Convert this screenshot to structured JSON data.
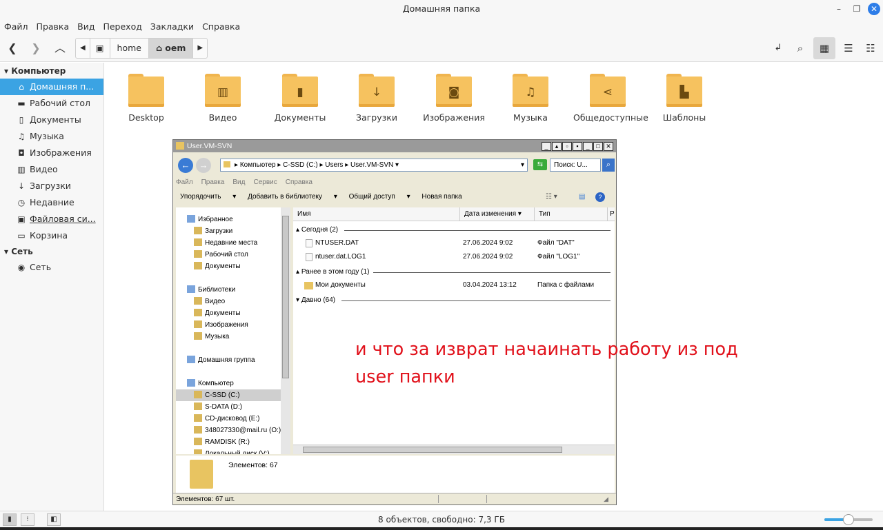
{
  "window": {
    "title": "Домашняя папка"
  },
  "menubar": [
    "Файл",
    "Правка",
    "Вид",
    "Переход",
    "Закладки",
    "Справка"
  ],
  "breadcrumb": [
    "home",
    "oem"
  ],
  "sidebar": {
    "sections": [
      {
        "title": "Компьютер",
        "items": [
          {
            "label": "Домашняя п...",
            "icon": "home-icon",
            "selected": true
          },
          {
            "label": "Рабочий стол",
            "icon": "desktop-icon"
          },
          {
            "label": "Документы",
            "icon": "document-icon"
          },
          {
            "label": "Музыка",
            "icon": "music-icon"
          },
          {
            "label": "Изображения",
            "icon": "camera-icon"
          },
          {
            "label": "Видео",
            "icon": "film-icon"
          },
          {
            "label": "Загрузки",
            "icon": "download-icon"
          },
          {
            "label": "Недавние",
            "icon": "clock-icon"
          },
          {
            "label": "Файловая си...",
            "icon": "drive-icon"
          },
          {
            "label": "Корзина",
            "icon": "trash-icon"
          }
        ]
      },
      {
        "title": "Сеть",
        "items": [
          {
            "label": "Сеть",
            "icon": "network-icon"
          }
        ]
      }
    ]
  },
  "folders": [
    {
      "label": "Desktop",
      "icon": "folder-icon"
    },
    {
      "label": "Видео",
      "icon": "film-icon"
    },
    {
      "label": "Документы",
      "icon": "document-icon"
    },
    {
      "label": "Загрузки",
      "icon": "download-icon"
    },
    {
      "label": "Изображения",
      "icon": "camera-icon"
    },
    {
      "label": "Музыка",
      "icon": "music-icon"
    },
    {
      "label": "Общедоступные",
      "icon": "share-icon"
    },
    {
      "label": "Шаблоны",
      "icon": "template-icon"
    }
  ],
  "status": {
    "text": "8 объектов, свободно: 7,3 ГБ",
    "zoom_level": 0.5
  },
  "screenshot": {
    "title": "User.VM-SVN",
    "address": [
      "Компьютер",
      "C-SSD (C:)",
      "Users",
      "User.VM-SVN"
    ],
    "search_placeholder": "Поиск: U...",
    "menu": [
      "Файл",
      "Правка",
      "Вид",
      "Сервис",
      "Справка"
    ],
    "commands": [
      "Упорядочить",
      "Добавить в библиотеку",
      "Общий доступ",
      "Новая папка"
    ],
    "nav": [
      {
        "label": "Избранное",
        "indent": 1
      },
      {
        "label": "Загрузки",
        "indent": 2
      },
      {
        "label": "Недавние места",
        "indent": 2
      },
      {
        "label": "Рабочий стол",
        "indent": 2
      },
      {
        "label": "Документы",
        "indent": 2
      },
      {
        "label": "",
        "indent": 0
      },
      {
        "label": "Библиотеки",
        "indent": 1
      },
      {
        "label": "Видео",
        "indent": 2
      },
      {
        "label": "Документы",
        "indent": 2
      },
      {
        "label": "Изображения",
        "indent": 2
      },
      {
        "label": "Музыка",
        "indent": 2
      },
      {
        "label": "",
        "indent": 0
      },
      {
        "label": "Домашняя группа",
        "indent": 1
      },
      {
        "label": "",
        "indent": 0
      },
      {
        "label": "Компьютер",
        "indent": 1
      },
      {
        "label": "C-SSD (C:)",
        "indent": 2,
        "selected": true
      },
      {
        "label": "S-DATA (D:)",
        "indent": 2
      },
      {
        "label": "CD-дисковод (E:)",
        "indent": 2
      },
      {
        "label": "348027330@mail.ru (O:)",
        "indent": 2
      },
      {
        "label": "RAMDISK (R:)",
        "indent": 2
      },
      {
        "label": "Локальный диск (V:)",
        "indent": 2
      }
    ],
    "columns": [
      "Имя",
      "Дата изменения",
      "Тип",
      "Р"
    ],
    "groups": [
      {
        "title": "Сегодня (2)",
        "rows": [
          {
            "name": "NTUSER.DAT",
            "date": "27.06.2024 9:02",
            "type": "Файл \"DAT\""
          },
          {
            "name": "ntuser.dat.LOG1",
            "date": "27.06.2024 9:02",
            "type": "Файл \"LOG1\""
          }
        ]
      },
      {
        "title": "Ранее в этом году (1)",
        "rows": [
          {
            "name": "Мои документы",
            "date": "03.04.2024 13:12",
            "type": "Папка с файлами"
          }
        ]
      },
      {
        "title": "Давно (64)",
        "rows": []
      }
    ],
    "details": "Элементов: 67",
    "statusbar": "Элементов: 67 шт."
  },
  "annotation": {
    "line1": "и что за изврат начаинать работу из под",
    "line2": "user папки",
    "color": "#e1101a"
  }
}
